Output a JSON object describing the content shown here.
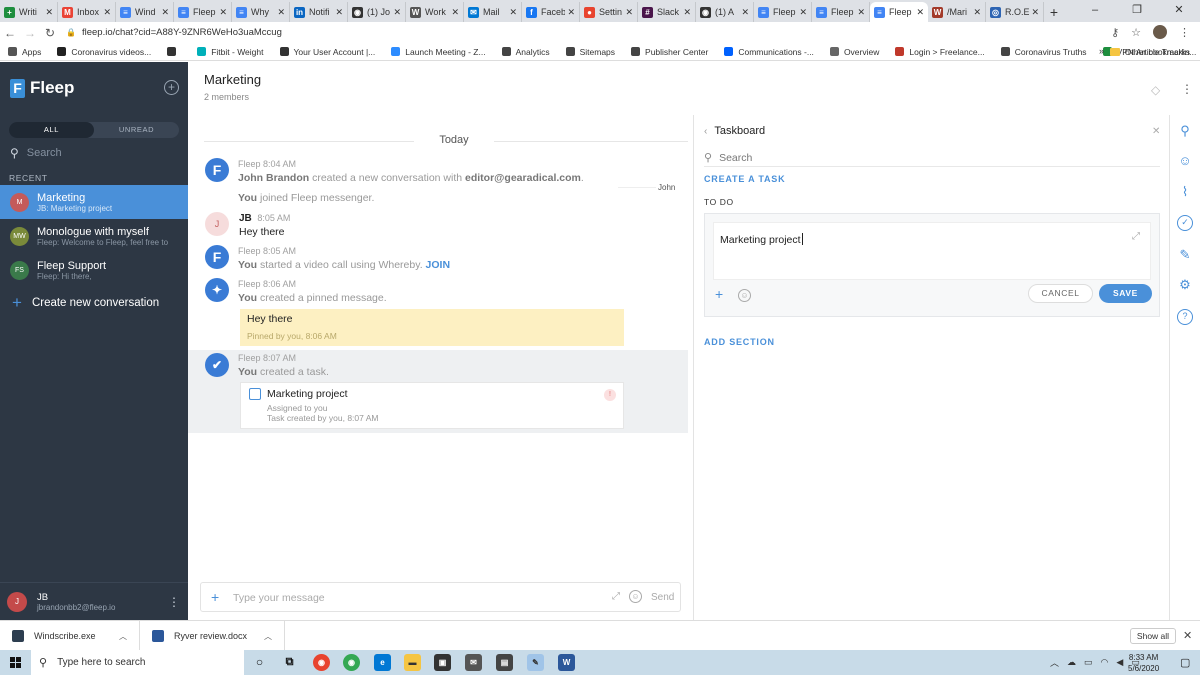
{
  "browser": {
    "tabs": [
      {
        "title": "Writi",
        "fav": "#1e8e3e",
        "glyph": "+"
      },
      {
        "title": "Inbox",
        "fav": "#ea4335",
        "glyph": "M"
      },
      {
        "title": "Wind",
        "fav": "#4285f4",
        "glyph": "≡"
      },
      {
        "title": "Fleep",
        "fav": "#4285f4",
        "glyph": "≡"
      },
      {
        "title": "Why",
        "fav": "#4285f4",
        "glyph": "≡"
      },
      {
        "title": "Notifi",
        "fav": "#0a66c2",
        "glyph": "in"
      },
      {
        "title": "(1) Jo",
        "fav": "#333333",
        "glyph": "◉"
      },
      {
        "title": "Work",
        "fav": "#555555",
        "glyph": "W"
      },
      {
        "title": "Mail",
        "fav": "#0078d4",
        "glyph": "✉"
      },
      {
        "title": "Faceb",
        "fav": "#1877f2",
        "glyph": "f"
      },
      {
        "title": "Settin",
        "fav": "#e8442f",
        "glyph": "●"
      },
      {
        "title": "Slack",
        "fav": "#4a154b",
        "glyph": "#"
      },
      {
        "title": "(1) A",
        "fav": "#333333",
        "glyph": "◉"
      },
      {
        "title": "Fleep",
        "fav": "#4285f4",
        "glyph": "≡"
      },
      {
        "title": "Fleep",
        "fav": "#4285f4",
        "glyph": "≡"
      },
      {
        "title": "Fleep",
        "fav": "#4285f4",
        "glyph": "≡",
        "active": true
      },
      {
        "title": "/Mari",
        "fav": "#a33a2a",
        "glyph": "W"
      },
      {
        "title": "R.O.E",
        "fav": "#2d64b3",
        "glyph": "◎"
      }
    ],
    "url": "fleep.io/chat?cid=A88Y-9ZNR6WeHo3uaMccug",
    "bookmarks": [
      {
        "label": "Apps",
        "color": "#555555"
      },
      {
        "label": "Coronavirus videos...",
        "color": "#222222"
      },
      {
        "label": "",
        "color": "#333333"
      },
      {
        "label": "Fitbit - Weight",
        "color": "#00b0b9"
      },
      {
        "label": "Your User Account |...",
        "color": "#333333"
      },
      {
        "label": "Launch Meeting - Z...",
        "color": "#2d8cff"
      },
      {
        "label": "Analytics",
        "color": "#444444"
      },
      {
        "label": "Sitemaps",
        "color": "#444444"
      },
      {
        "label": "Publisher Center",
        "color": "#444444"
      },
      {
        "label": "Communications -...",
        "color": "#0061fe"
      },
      {
        "label": "Overview",
        "color": "#666666"
      },
      {
        "label": "Login > Freelance...",
        "color": "#c0392b"
      },
      {
        "label": "Coronavirus Truths",
        "color": "#444444"
      },
      {
        "label": "VPN Article Trackin...",
        "color": "#1e8e3e"
      }
    ],
    "more": "»",
    "other_bookmarks": "Other bookmarks"
  },
  "sidebar": {
    "logo": "Fleep",
    "segments": {
      "all": "ALL",
      "unread": "UNREAD"
    },
    "search_placeholder": "Search",
    "recent_label": "RECENT",
    "conversations": [
      {
        "initials": "M",
        "name": "Marketing",
        "snippet": "JB: Marketing project",
        "avatar_color": "#c45a5a",
        "selected": true
      },
      {
        "initials": "MW",
        "name": "Monologue with myself",
        "snippet": "Fleep: Welcome to Fleep, feel free to",
        "avatar_color": "#7a8a3a"
      },
      {
        "initials": "FS",
        "name": "Fleep Support",
        "snippet": "Fleep: Hi there,",
        "avatar_color": "#3a7a4a"
      }
    ],
    "create_new": "Create new conversation",
    "user": {
      "initials": "J",
      "name": "JB",
      "email": "jbrandonbb2@fleep.io"
    }
  },
  "header": {
    "title": "Marketing",
    "subtitle": "2 members"
  },
  "chat": {
    "day_divider": "Today",
    "messages": {
      "m1": {
        "time": "Fleep 8:04 AM",
        "author": "John Brandon",
        "text1": "created a new conversation with",
        "email": "editor@gearadical.com",
        "dot": "."
      },
      "m1b": {
        "author": "You",
        "text": "joined Fleep messenger."
      },
      "john_tag": "John",
      "m2": {
        "author": "JB",
        "time": "8:05 AM",
        "text": "Hey there"
      },
      "m3": {
        "time": "Fleep 8:05 AM",
        "author": "You",
        "text": "started a video call using Whereby.",
        "join": "JOIN"
      },
      "m4": {
        "time": "Fleep 8:06 AM",
        "author": "You",
        "text": "created a pinned message."
      },
      "pinned": {
        "text": "Hey there",
        "sub": "Pinned by you, 8:06 AM"
      },
      "m5": {
        "time": "Fleep 8:07 AM",
        "author": "You",
        "text": "created a task."
      },
      "task": {
        "name": "Marketing project",
        "assigned": "Assigned to you",
        "created": "Task created by you, 8:07 AM"
      }
    },
    "composer": {
      "placeholder": "Type your message",
      "send": "Send"
    }
  },
  "taskboard": {
    "title": "Taskboard",
    "search_placeholder": "Search",
    "create_task": "CREATE A TASK",
    "section": "TO DO",
    "task_input_value": "Marketing project",
    "cancel": "CANCEL",
    "save": "SAVE",
    "add_section": "ADD SECTION"
  },
  "downloads": {
    "items": [
      {
        "name": "Windscribe.exe",
        "color": "#2d3e50"
      },
      {
        "name": "Ryver review.docx",
        "color": "#2b579a"
      }
    ],
    "show_all": "Show all"
  },
  "taskbar": {
    "search_placeholder": "Type here to search",
    "time": "8:33 AM",
    "date": "5/6/2020"
  },
  "colors": {
    "accent": "#4a90d9",
    "sidebar_bg": "#2d3744",
    "pinned_bg": "#fdf0c2"
  }
}
